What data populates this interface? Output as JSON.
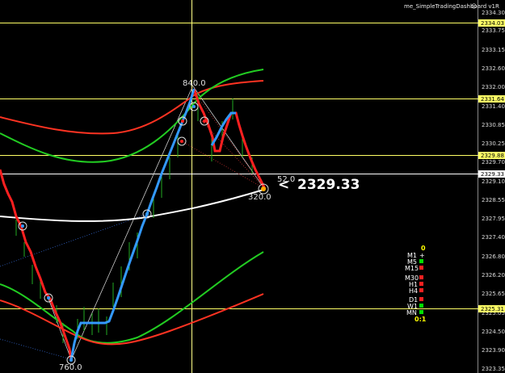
{
  "indicator_title": "me_SimpleTradingDashboard v1R",
  "smiley_glyph": "☺",
  "price_axis": {
    "ticks": [
      "2334.30",
      "2333.75",
      "2333.15",
      "2332.60",
      "2332.00",
      "2331.40",
      "2330.85",
      "2330.25",
      "2329.70",
      "2329.10",
      "2328.55",
      "2327.95",
      "2327.40",
      "2326.80",
      "2326.20",
      "2325.65",
      "2325.05",
      "2324.50",
      "2323.90",
      "2323.35"
    ]
  },
  "price_lines": [
    {
      "label": "2334.03"
    },
    {
      "label": "2331.64"
    },
    {
      "label": "2329.88"
    },
    {
      "label": "2329.33"
    },
    {
      "label": "2325.31"
    }
  ],
  "swing_labels": {
    "high": "840.0",
    "low": "760.0",
    "recent": "320.0",
    "small": "52.0"
  },
  "current_price": {
    "arrow": "<",
    "value": "2329.33"
  },
  "dashboard": {
    "top_value": "0",
    "timeframes": [
      {
        "label": "M1",
        "status": "+",
        "color": "#ffffff"
      },
      {
        "label": "M5",
        "status": "■",
        "color": "#00e000"
      },
      {
        "label": "M15",
        "status": "■",
        "color": "#ff2020"
      },
      {
        "label": "M30",
        "status": "■",
        "color": "#ff2020"
      },
      {
        "label": "H1",
        "status": "■",
        "color": "#ff2020"
      },
      {
        "label": "H4",
        "status": "■",
        "color": "#ff2020"
      },
      {
        "label": "D1",
        "status": "■",
        "color": "#ff2020"
      },
      {
        "label": "W1",
        "status": "■",
        "color": "#00e000"
      },
      {
        "label": "MN",
        "status": "■",
        "color": "#00e000"
      }
    ],
    "ratio": "0:1"
  },
  "colors": {
    "background": "#000000",
    "price_line": "#ffff66",
    "current_line": "#ffffff",
    "bull_zigzag": "#3399ff",
    "bear_zigzag": "#ff2020",
    "band_green": "#22cc22",
    "band_red": "#ff3322",
    "band_white": "#ffffff",
    "candle": "#22aa22"
  }
}
